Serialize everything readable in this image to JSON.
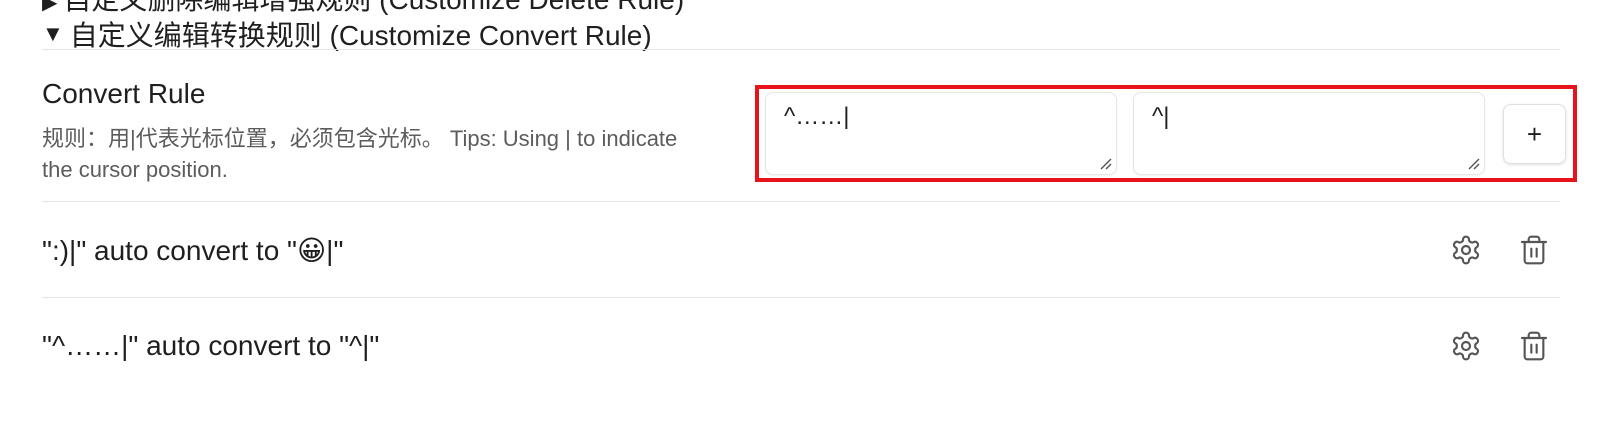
{
  "previous_section": {
    "heading": "自定义删除编辑增强规则 (Customize Delete Rule)",
    "collapsed_glyph": "▶"
  },
  "section": {
    "heading": "自定义编辑转换规则 (Customize Convert Rule)",
    "expanded_glyph": "▼"
  },
  "setting": {
    "name": "Convert Rule",
    "description": "规则：用|代表光标位置，必须包含光标。 Tips: Using | to indicate the cursor position."
  },
  "inputs": {
    "from_value": "^……|",
    "to_value": "^|",
    "add_label": "+",
    "highlight_color": "#e8121b"
  },
  "rules": [
    {
      "text": "\":)|\" auto convert to \"😀|\"",
      "settings_icon": "gear-icon",
      "delete_icon": "trash-icon"
    },
    {
      "text": "\"^……|\" auto convert to \"^|\"",
      "settings_icon": "gear-icon",
      "delete_icon": "trash-icon"
    }
  ]
}
